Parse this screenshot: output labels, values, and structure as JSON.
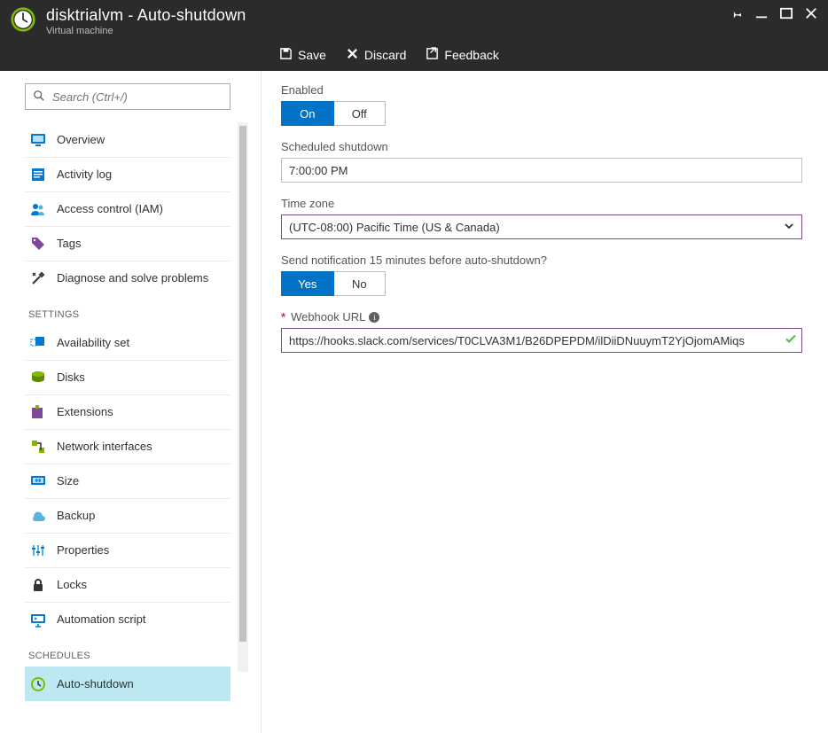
{
  "header": {
    "title": "disktrialvm - Auto-shutdown",
    "subtitle": "Virtual machine"
  },
  "commands": {
    "save": "Save",
    "discard": "Discard",
    "feedback": "Feedback"
  },
  "search": {
    "placeholder": "Search (Ctrl+/)"
  },
  "sidebar": {
    "general": [
      {
        "label": "Overview"
      },
      {
        "label": "Activity log"
      },
      {
        "label": "Access control (IAM)"
      },
      {
        "label": "Tags"
      },
      {
        "label": "Diagnose and solve problems"
      }
    ],
    "settings_header": "SETTINGS",
    "settings": [
      {
        "label": "Availability set"
      },
      {
        "label": "Disks"
      },
      {
        "label": "Extensions"
      },
      {
        "label": "Network interfaces"
      },
      {
        "label": "Size"
      },
      {
        "label": "Backup"
      },
      {
        "label": "Properties"
      },
      {
        "label": "Locks"
      },
      {
        "label": "Automation script"
      }
    ],
    "schedules_header": "SCHEDULES",
    "schedules": [
      {
        "label": "Auto-shutdown"
      }
    ]
  },
  "form": {
    "enabled_label": "Enabled",
    "on_label": "On",
    "off_label": "Off",
    "scheduled_label": "Scheduled shutdown",
    "scheduled_value": "7:00:00 PM",
    "tz_label": "Time zone",
    "tz_value": "(UTC-08:00) Pacific Time (US & Canada)",
    "notify_label": "Send notification 15 minutes before auto-shutdown?",
    "yes_label": "Yes",
    "no_label": "No",
    "webhook_label": "Webhook URL",
    "webhook_value": "https://hooks.slack.com/services/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"
  }
}
